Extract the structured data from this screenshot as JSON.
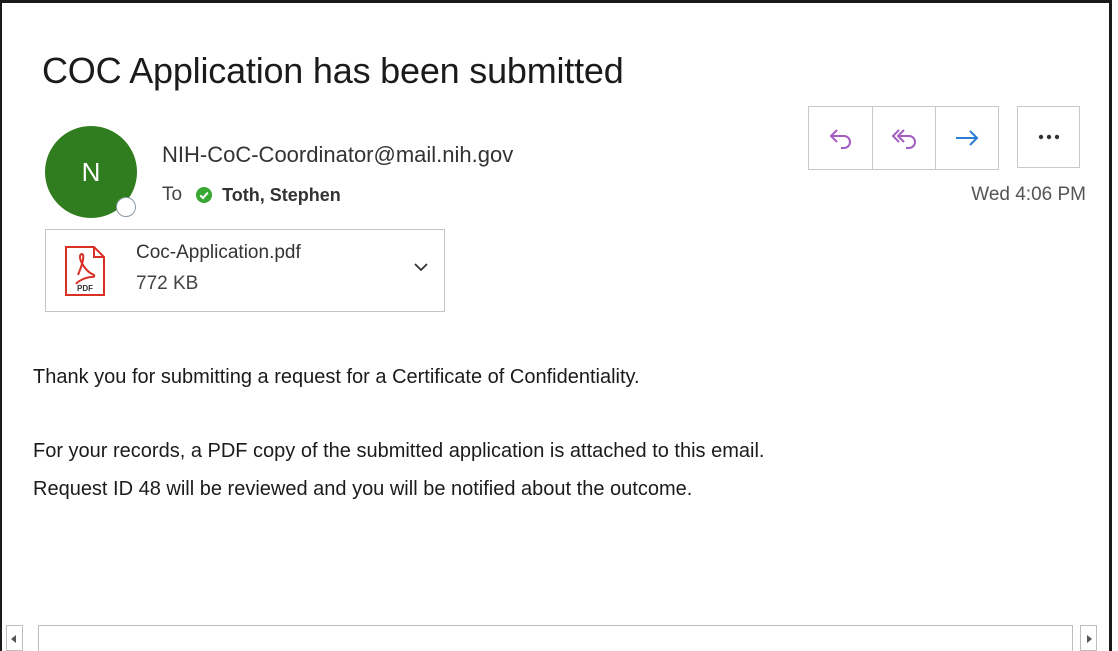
{
  "email": {
    "subject": "COC Application has been submitted",
    "sender": "NIH-CoC-Coordinator@mail.nih.gov",
    "avatar_initial": "N",
    "to_label": "To",
    "recipient": "Toth,  Stephen",
    "timestamp": "Wed 4:06 PM"
  },
  "attachment": {
    "name": "Coc-Application.pdf",
    "size": "772 KB",
    "icon_label": "PDF"
  },
  "body": {
    "line1": "Thank you for submitting a request for a Certificate of Confidentiality.",
    "line2": "For your records, a PDF copy of the submitted application is attached to this email.",
    "line3": "Request ID 48 will be reviewed and you will be notified about the outcome."
  },
  "actions": {
    "reply_icon": "reply-icon",
    "reply_all_icon": "reply-all-icon",
    "forward_icon": "forward-icon",
    "more_icon": "more-icon"
  },
  "colors": {
    "avatar": "#2f7d1e",
    "reply_accent": "#a45dc4",
    "forward_accent": "#2b7cd3",
    "presence_check": "#38a832",
    "pdf_red": "#d93025"
  }
}
